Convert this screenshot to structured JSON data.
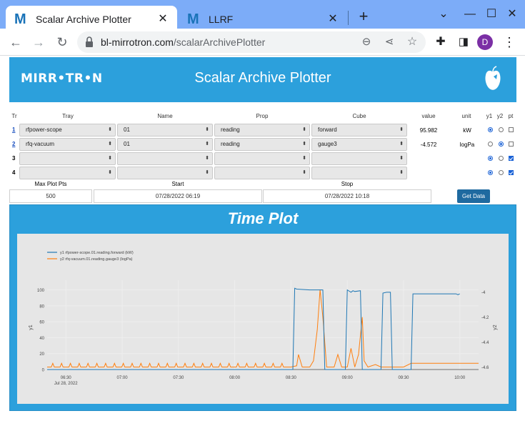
{
  "browser": {
    "tabs": [
      {
        "title": "Scalar Archive Plotter",
        "favicon": "M"
      },
      {
        "title": "LLRF",
        "favicon": "M"
      }
    ],
    "url_host": "bl-mirrotron.com",
    "url_path": "/scalarArchivePlotter",
    "profile_initial": "D"
  },
  "header": {
    "logo": "MIRR•TR•N",
    "title": "Scalar Archive Plotter"
  },
  "form": {
    "columns": {
      "tr": "Tr",
      "tray": "Tray",
      "name": "Name",
      "prop": "Prop",
      "cube": "Cube",
      "value": "value",
      "unit": "unit",
      "y1": "y1",
      "y2": "y2",
      "pt": "pt"
    },
    "rows": [
      {
        "num": "1",
        "tray": "rfpower-scope",
        "name": "01",
        "prop": "reading",
        "cube": "forward",
        "value": "95.982",
        "unit": "kW",
        "y1": true,
        "y2": false,
        "pt": false
      },
      {
        "num": "2",
        "tray": "rfq-vacuum",
        "name": "01",
        "prop": "reading",
        "cube": "gauge3",
        "value": "-4.572",
        "unit": "logPa",
        "y1": false,
        "y2": true,
        "pt": false
      },
      {
        "num": "3",
        "tray": "",
        "name": "",
        "prop": "",
        "cube": "",
        "value": "",
        "unit": "",
        "y1": true,
        "y2": false,
        "pt": true
      },
      {
        "num": "4",
        "tray": "",
        "name": "",
        "prop": "",
        "cube": "",
        "value": "",
        "unit": "",
        "y1": true,
        "y2": false,
        "pt": true
      }
    ],
    "max_plot_pts_label": "Max Plot Pts",
    "max_plot_pts": "500",
    "start_label": "Start",
    "start": "07/28/2022 06:19",
    "stop_label": "Stop",
    "stop": "07/28/2022 10:18",
    "get_data_label": "Get Data"
  },
  "plot": {
    "title": "Time Plot"
  },
  "colors": {
    "header_bg": "#2ca0dc",
    "series1": "#1f77b4",
    "series2": "#ff7f0e",
    "button": "#1f6aa0"
  },
  "chart_data": {
    "type": "line",
    "xlabel": "",
    "ylabel": "y1",
    "y2label": "y2",
    "x_ticks": [
      "06:30",
      "07:00",
      "07:30",
      "08:00",
      "08:30",
      "09:00",
      "09:30",
      "10:00"
    ],
    "x_tick_sub": "Jul 28, 2022",
    "y1_ticks": [
      "0",
      "20",
      "40",
      "60",
      "80",
      "100"
    ],
    "y2_ticks": [
      "-4.6",
      "-4.4",
      "-4.2",
      "-4"
    ],
    "y1_lim": [
      0,
      105
    ],
    "y2_lim": [
      -4.62,
      -3.95
    ],
    "x_range_minutes": [
      -15,
      20
    ],
    "series": [
      {
        "name": "y1 rfpower-scope.01.reading.forward (kW)",
        "axis": "y1",
        "points": [
          [
            -25,
            0
          ],
          [
            131,
            0
          ],
          [
            132,
            102
          ],
          [
            133,
            101
          ],
          [
            140,
            100
          ],
          [
            147,
            100
          ],
          [
            148,
            0
          ],
          [
            159,
            0
          ],
          [
            160,
            100
          ],
          [
            162,
            97
          ],
          [
            163,
            99
          ],
          [
            164,
            98
          ],
          [
            167,
            99
          ],
          [
            168,
            0
          ],
          [
            178,
            0
          ],
          [
            179,
            96
          ],
          [
            181,
            97
          ],
          [
            183,
            97
          ],
          [
            184,
            0
          ],
          [
            194,
            0
          ],
          [
            195,
            95
          ],
          [
            205,
            95
          ],
          [
            218,
            95
          ],
          [
            219,
            94
          ],
          [
            220,
            95
          ]
        ]
      },
      {
        "name": "y2 rfq-vacuum.01.reading.gauge3 (logPa)",
        "axis": "y2",
        "points": []
      }
    ]
  }
}
